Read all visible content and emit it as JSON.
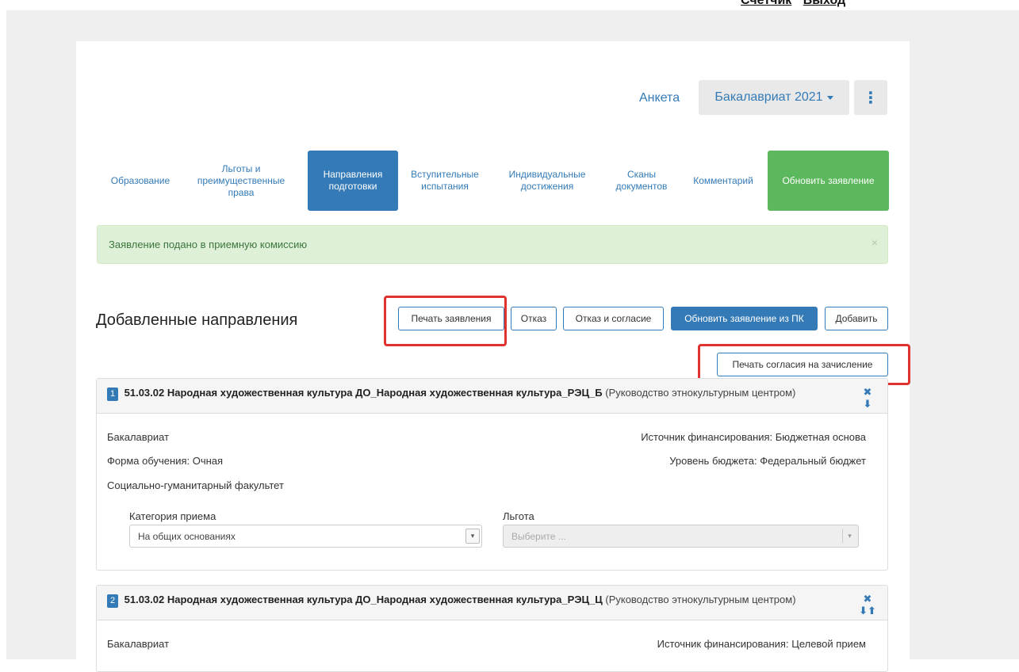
{
  "topbar": {
    "link1": "Счетчик",
    "link2": "Выход"
  },
  "header": {
    "anketa": "Анкета",
    "level_select": "Бакалавриат 2021",
    "more_icon": "⋮"
  },
  "tabs": [
    {
      "label": "Образование"
    },
    {
      "label": "Льготы и преимущественные права"
    },
    {
      "label": "Направления подготовки"
    },
    {
      "label": "Вступительные испытания"
    },
    {
      "label": "Индивидуальные достижения"
    },
    {
      "label": "Сканы документов"
    },
    {
      "label": "Комментарий"
    },
    {
      "label": "Обновить заявление"
    }
  ],
  "alert": {
    "text": "Заявление подано в приемную комиссию",
    "close": "×"
  },
  "section": {
    "title": "Добавленные направления",
    "buttons": {
      "print": "Печать заявления",
      "refuse": "Отказ",
      "refuse_agree": "Отказ и согласие",
      "update_from_pk": "Обновить заявление из ПК",
      "add": "Добавить",
      "print_consent": "Печать согласия на зачисление"
    }
  },
  "directions": [
    {
      "number": "1",
      "title": "51.03.02 Народная художественная культура ДО_Народная художественная культура_РЭЦ_Б",
      "subtitle": "(Руководство этнокультурным центром)",
      "level": "Бакалавриат",
      "funding": "Источник финансирования: Бюджетная основа",
      "form": "Форма обучения: Очная",
      "budget_level": "Уровень бюджета: Федеральный бюджет",
      "faculty": "Социально-гуманитарный факультет",
      "category_label": "Категория приема",
      "category_value": "На общих основаниях",
      "benefit_label": "Льгота",
      "benefit_placeholder": "Выберите ..."
    },
    {
      "number": "2",
      "title": "51.03.02 Народная художественная культура ДО_Народная художественная культура_РЭЦ_Ц",
      "subtitle": "(Руководство этнокультурным центром)",
      "level": "Бакалавриат",
      "funding": "Источник финансирования: Целевой прием"
    }
  ],
  "colors": {
    "primary": "#337ab7",
    "success": "#5cb85c",
    "alert_bg": "#dff0d8",
    "highlight": "#e0322f"
  }
}
